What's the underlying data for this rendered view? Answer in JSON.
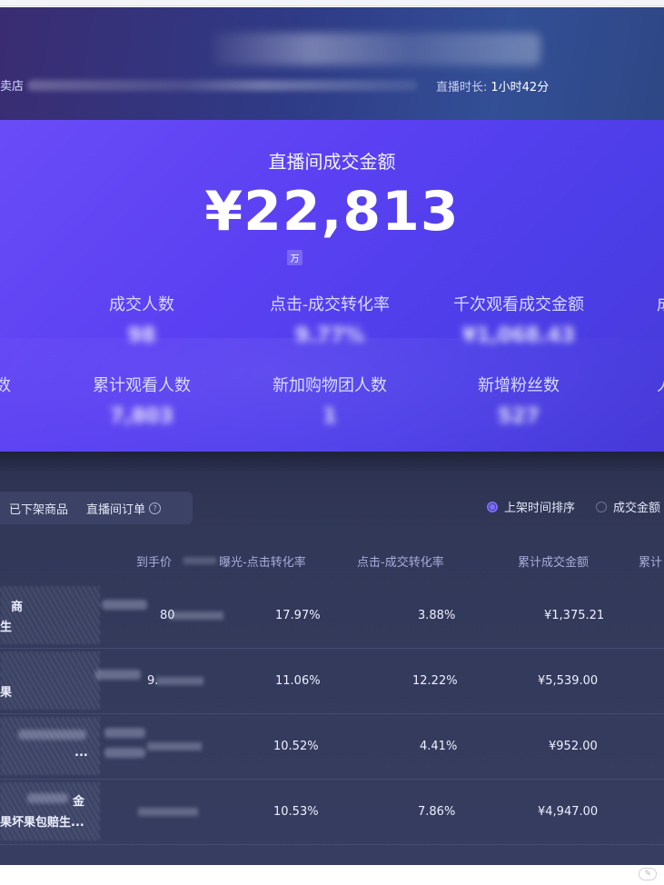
{
  "header": {
    "store_label": "卖店",
    "duration_label": "直播时长:",
    "duration_value": "1小时42分"
  },
  "hero": {
    "title": "直播间成交金额",
    "value": "¥22,813",
    "unit": "万",
    "metrics_row1": [
      {
        "label": "成交人数",
        "value": "98"
      },
      {
        "label": "点击-成交转化率",
        "value": "9.77%"
      },
      {
        "label": "千次观看成交金额",
        "value": "¥1,068.43"
      }
    ],
    "metrics_row2": [
      {
        "label": "累计观看人数",
        "value": "7,803"
      },
      {
        "label": "新加购物团人数",
        "value": "1"
      },
      {
        "label": "新增粉丝数",
        "value": "527"
      }
    ],
    "edge_right_1": "成",
    "edge_left_2": "数",
    "edge_right_2": "人"
  },
  "tabs": [
    {
      "label": "已下架商品"
    },
    {
      "label": "直播间订单"
    }
  ],
  "sort": {
    "option1": "上架时间排序",
    "option2": "成交金额"
  },
  "table": {
    "headers": [
      "到手价",
      "曝光-点击转化率",
      "点击-成交转化率",
      "累计成交金额",
      "累计"
    ],
    "rows": [
      {
        "name1": "商",
        "name2": "生",
        "price": "80",
        "ctr": "17.97%",
        "cvr": "3.88%",
        "amount": "¥1,375.21"
      },
      {
        "name1": "",
        "name2": "果",
        "price": "9.",
        "ctr": "11.06%",
        "cvr": "12.22%",
        "amount": "¥5,539.00"
      },
      {
        "name1": "",
        "name2": "...",
        "price": "",
        "ctr": "10.52%",
        "cvr": "4.41%",
        "amount": "¥952.00"
      },
      {
        "name1": "金",
        "name2": "果坏果包赔生...",
        "price": "",
        "ctr": "10.53%",
        "cvr": "7.86%",
        "amount": "¥4,947.00"
      }
    ]
  },
  "colors": {
    "hero_bg": "#5a40f2",
    "panel_bg": "#323858",
    "accent": "#7d6cff"
  }
}
